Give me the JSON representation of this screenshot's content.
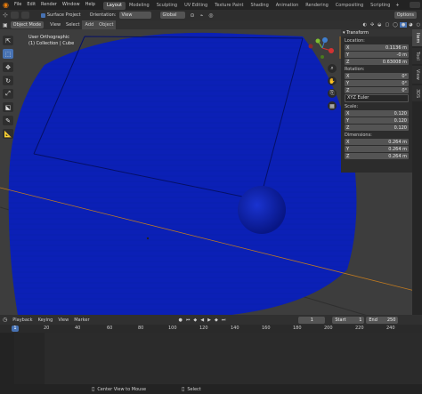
{
  "topbar": {
    "menus": [
      "File",
      "Edit",
      "Render",
      "Window",
      "Help"
    ],
    "workspaces": [
      "Layout",
      "Modeling",
      "Sculpting",
      "UV Editing",
      "Texture Paint",
      "Shading",
      "Animation",
      "Rendering",
      "Compositing",
      "Scripting"
    ],
    "active_workspace": "Layout"
  },
  "toolbar": {
    "surface_project": "Surface Project",
    "orientation_label": "Orientation:",
    "orientation_value": "View",
    "transform_orientation": "Global",
    "options": "Options"
  },
  "vpheader": {
    "mode": "Object Mode",
    "menus": [
      "View",
      "Select",
      "Add",
      "Object"
    ]
  },
  "viewport": {
    "view_name": "User Orthographic",
    "collection": "(1) Collection | Cube",
    "cube_color": "#0a1fb5",
    "background": "#3d3d3d"
  },
  "npanel": {
    "transform_title": "Transform",
    "location_label": "Location:",
    "location": [
      {
        "axis": "X",
        "value": "0.1136 m"
      },
      {
        "axis": "Y",
        "value": "-0 m"
      },
      {
        "axis": "Z",
        "value": "0.63008 m"
      }
    ],
    "rotation_label": "Rotation:",
    "rotation": [
      {
        "axis": "X",
        "value": "0°"
      },
      {
        "axis": "Y",
        "value": "0°"
      },
      {
        "axis": "Z",
        "value": "0°"
      }
    ],
    "rotation_mode": "XYZ Euler",
    "scale_label": "Scale:",
    "scale": [
      {
        "axis": "X",
        "value": "0.120"
      },
      {
        "axis": "Y",
        "value": "0.120"
      },
      {
        "axis": "Z",
        "value": "0.120"
      }
    ],
    "dimensions_label": "Dimensions:",
    "dimensions": [
      {
        "axis": "X",
        "value": "0.264 m"
      },
      {
        "axis": "Y",
        "value": "0.264 m"
      },
      {
        "axis": "Z",
        "value": "0.264 m"
      }
    ]
  },
  "sidetabs": [
    "Item",
    "Tool",
    "View",
    "3DS"
  ],
  "timeline": {
    "menus": [
      "Playback",
      "Keying",
      "View",
      "Marker"
    ],
    "current_frame": "1",
    "start_label": "Start",
    "start": "1",
    "end_label": "End",
    "end": "250",
    "ticks": [
      "1",
      "20",
      "40",
      "60",
      "80",
      "100",
      "120",
      "140",
      "160",
      "180",
      "200",
      "220",
      "240"
    ]
  },
  "status": {
    "center_view": "Center View to Mouse",
    "select": "Select"
  }
}
